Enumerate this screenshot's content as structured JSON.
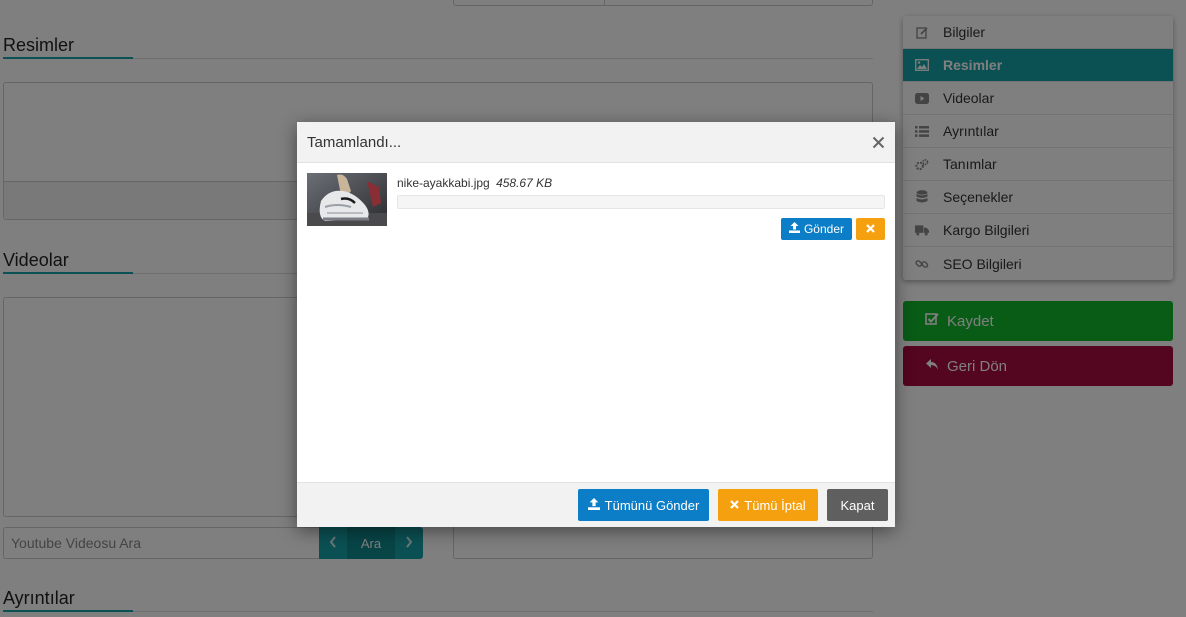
{
  "sections": {
    "images_title": "Resimler",
    "videos_title": "Videolar",
    "details_title": "Ayrıntılar"
  },
  "youtube_search": {
    "placeholder": "Youtube Videosu Ara",
    "button_label": "Ara",
    "prev_icon": "chevron-left-icon",
    "next_icon": "chevron-right-icon"
  },
  "sidebar": {
    "items": [
      {
        "label": "Bilgiler",
        "icon": "edit-icon",
        "active": false
      },
      {
        "label": "Resimler",
        "icon": "image-icon",
        "active": true
      },
      {
        "label": "Videolar",
        "icon": "video-icon",
        "active": false
      },
      {
        "label": "Ayrıntılar",
        "icon": "list-icon",
        "active": false
      },
      {
        "label": "Tanımlar",
        "icon": "gears-icon",
        "active": false
      },
      {
        "label": "Seçenekler",
        "icon": "database-icon",
        "active": false
      },
      {
        "label": "Kargo Bilgileri",
        "icon": "truck-icon",
        "active": false
      },
      {
        "label": "SEO Bilgileri",
        "icon": "link-icon",
        "active": false
      }
    ]
  },
  "actions": {
    "save_label": "Kaydet",
    "back_label": "Geri Dön"
  },
  "modal": {
    "title": "Tamamlandı...",
    "close_icon": "close-icon",
    "file": {
      "name": "nike-ayakkabi.jpg",
      "size": "458.67 KB",
      "progress": 0,
      "send_label": "Gönder"
    },
    "footer": {
      "send_all_label": "Tümünü Gönder",
      "cancel_all_label": "Tümü İptal",
      "close_label": "Kapat"
    }
  },
  "colors": {
    "accent": "#17a2a8",
    "primary": "#0b7ec7",
    "warning": "#f5a00f",
    "success": "#10b92c",
    "danger": "#a90a3f",
    "neutral": "#5f5f5f"
  }
}
